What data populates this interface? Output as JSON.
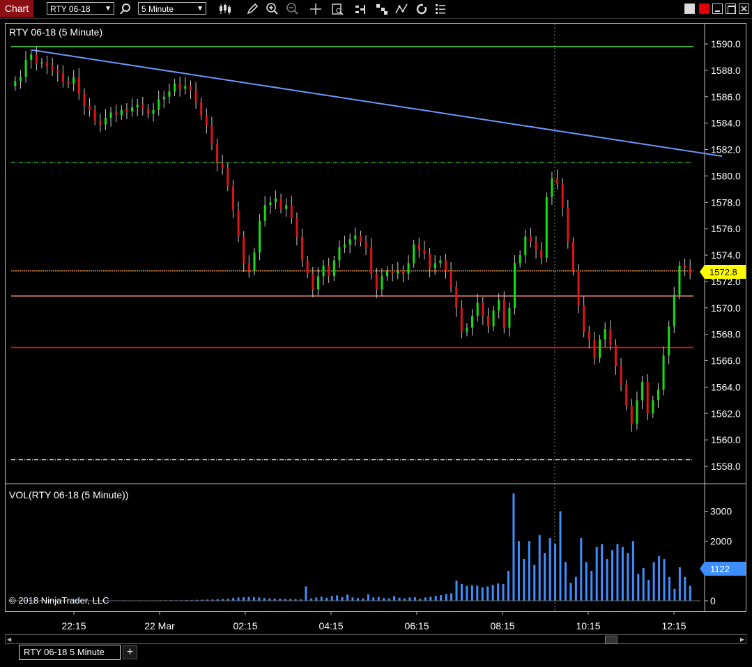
{
  "window": {
    "tab_label": "Chart",
    "instrument_select": "RTY 06-18",
    "interval_select": "5 Minute",
    "bottom_tab_label": "RTY 06-18 5 Minute",
    "add_tab_label": "+"
  },
  "toolbar_icons": [
    "search-icon",
    "bar-type-icon",
    "pencil-icon",
    "zoom-in-icon",
    "zoom-out-icon",
    "crosshair-icon",
    "data-box-icon",
    "indicators-icon",
    "strategies-icon",
    "drawing-tools-icon",
    "refresh-icon",
    "properties-icon"
  ],
  "colors": {
    "up": "#14e014",
    "down": "#e01414",
    "trend": "#6f95ff",
    "volume": "#3d8fff",
    "price_marker": "#ffff00",
    "tab_bg": "#8b0f14"
  },
  "price_panel": {
    "title": "RTY 06-18 (5 Minute)",
    "price_marker_label": "1572.8",
    "y_ticks": [
      "1590.0",
      "1588.0",
      "1586.0",
      "1584.0",
      "1582.0",
      "1580.0",
      "1578.0",
      "1576.0",
      "1574.0",
      "1572.0",
      "1570.0",
      "1568.0",
      "1566.0",
      "1564.0",
      "1562.0",
      "1560.0",
      "1558.0"
    ]
  },
  "volume_panel": {
    "title": "VOL(RTY 06-18 (5 Minute))",
    "marker_label": "1122",
    "y_ticks": [
      "3000",
      "2000",
      "0"
    ],
    "copyright": "© 2018 NinjaTrader, LLC"
  },
  "x_ticks": [
    "22:15",
    "22 Mar",
    "02:15",
    "04:15",
    "06:15",
    "08:15",
    "10:15",
    "12:15"
  ],
  "chart_data": [
    {
      "type": "candlestick",
      "title": "RTY 06-18 (5 Minute)",
      "ylim": [
        1557.5,
        1591.5
      ],
      "series": [
        {
          "name": "RTY 06-18",
          "open": [
            1586.8,
            1587.2,
            1587.5,
            1588.8,
            1589.2,
            1588.5,
            1588.6,
            1588.3,
            1588.0,
            1587.8,
            1587.2,
            1587.0,
            1587.5,
            1586.2,
            1585.3,
            1585.0,
            1584.2,
            1583.9,
            1584.4,
            1584.8,
            1584.6,
            1585.0,
            1584.9,
            1585.2,
            1585.4,
            1585.1,
            1584.7,
            1585.0,
            1585.8,
            1586.0,
            1586.4,
            1587.0,
            1586.6,
            1586.8,
            1586.5,
            1585.6,
            1584.6,
            1583.8,
            1582.4,
            1581.0,
            1580.6,
            1579.2,
            1577.4,
            1575.4,
            1573.4,
            1572.8,
            1574.2,
            1576.6,
            1577.8,
            1578.0,
            1578.3,
            1577.5,
            1577.8,
            1576.8,
            1575.4,
            1573.6,
            1572.6,
            1571.4,
            1572.4,
            1573.2,
            1572.4,
            1573.6,
            1574.6,
            1574.8,
            1575.2,
            1575.5,
            1575.0,
            1574.6,
            1572.6,
            1571.4,
            1572.4,
            1572.8,
            1572.6,
            1572.8,
            1572.6,
            1573.4,
            1574.8,
            1574.4,
            1574.1,
            1573.0,
            1573.4,
            1573.6,
            1572.8,
            1571.6,
            1570.0,
            1568.2,
            1568.5,
            1569.4,
            1570.4,
            1569.4,
            1568.6,
            1569.8,
            1570.6,
            1568.5,
            1570.0,
            1573.4,
            1574.0,
            1575.4,
            1575.0,
            1574.4,
            1573.8,
            1578.4,
            1579.8,
            1579.4,
            1577.6,
            1575.0,
            1572.8,
            1570.2,
            1568.2,
            1567.6,
            1566.2,
            1567.6,
            1568.4,
            1567.2,
            1565.6,
            1564.2,
            1562.6,
            1561.2,
            1563.0,
            1564.4,
            1562.0,
            1563.0,
            1563.8,
            1566.4,
            1568.6,
            1571.0,
            1573.2,
            1573.0
          ],
          "close": [
            1587.2,
            1587.5,
            1588.8,
            1589.2,
            1588.5,
            1588.6,
            1588.3,
            1588.0,
            1587.8,
            1587.2,
            1587.0,
            1587.5,
            1586.2,
            1585.3,
            1585.0,
            1584.2,
            1583.9,
            1584.4,
            1584.8,
            1584.6,
            1585.0,
            1584.9,
            1585.2,
            1585.4,
            1585.1,
            1584.7,
            1585.0,
            1585.8,
            1586.0,
            1586.4,
            1587.0,
            1586.6,
            1586.8,
            1586.5,
            1585.6,
            1584.6,
            1583.8,
            1582.4,
            1581.0,
            1580.6,
            1579.2,
            1577.4,
            1575.4,
            1573.4,
            1572.8,
            1574.2,
            1576.6,
            1577.8,
            1578.0,
            1578.3,
            1577.5,
            1577.8,
            1576.8,
            1575.4,
            1573.6,
            1572.6,
            1571.4,
            1572.4,
            1573.2,
            1572.4,
            1573.6,
            1574.6,
            1574.8,
            1575.2,
            1575.5,
            1575.0,
            1574.6,
            1572.6,
            1571.4,
            1572.4,
            1572.8,
            1572.6,
            1572.8,
            1572.6,
            1573.4,
            1574.8,
            1574.4,
            1574.1,
            1573.0,
            1573.4,
            1573.6,
            1572.8,
            1571.6,
            1570.0,
            1568.2,
            1568.5,
            1569.4,
            1570.4,
            1569.4,
            1568.6,
            1569.8,
            1570.6,
            1568.5,
            1570.0,
            1573.4,
            1574.0,
            1575.4,
            1575.0,
            1574.4,
            1573.8,
            1578.4,
            1579.8,
            1579.4,
            1577.6,
            1575.0,
            1572.8,
            1570.2,
            1568.2,
            1567.6,
            1566.2,
            1567.6,
            1568.4,
            1567.2,
            1565.6,
            1564.2,
            1562.6,
            1561.2,
            1563.0,
            1564.4,
            1562.0,
            1563.0,
            1563.8,
            1566.4,
            1568.6,
            1571.0,
            1573.2,
            1573.0,
            1572.6
          ]
        }
      ],
      "horizontal_lines": [
        {
          "price": 1589.8,
          "color": "#3fbf3f",
          "style": "solid"
        },
        {
          "price": 1581.0,
          "color": "#2fa02f",
          "style": "dashdot"
        },
        {
          "price": 1572.8,
          "color": "#ffa040",
          "style": "dotted"
        },
        {
          "price": 1570.9,
          "color": "#ff8a80",
          "style": "solid"
        },
        {
          "price": 1567.0,
          "color": "#e01414",
          "style": "solid"
        },
        {
          "price": 1558.5,
          "color": "#dddddd",
          "style": "dashdot"
        }
      ],
      "trend_line": {
        "from_price": 1589.8,
        "to_price": 1581.6
      }
    },
    {
      "type": "bar",
      "title": "VOL(RTY 06-18 (5 Minute))",
      "ylim": [
        0,
        3700
      ],
      "series": [
        {
          "name": "VOL",
          "values": [
            20,
            15,
            18,
            25,
            22,
            20,
            15,
            18,
            20,
            15,
            12,
            18,
            20,
            15,
            16,
            14,
            12,
            15,
            18,
            15,
            12,
            16,
            14,
            12,
            15,
            14,
            12,
            15,
            18,
            16,
            20,
            15,
            18,
            22,
            25,
            30,
            35,
            40,
            45,
            55,
            60,
            70,
            90,
            110,
            120,
            130,
            120,
            110,
            90,
            80,
            75,
            70,
            65,
            60,
            55,
            50,
            480,
            80,
            110,
            140,
            100,
            160,
            180,
            120,
            210,
            110,
            90,
            80,
            220,
            110,
            130,
            90,
            80,
            160,
            100,
            80,
            110,
            120,
            70,
            110,
            140,
            160,
            190,
            230,
            250,
            680,
            560,
            500,
            520,
            500,
            450,
            480,
            530,
            580,
            560,
            1000,
            3600,
            2000,
            1400,
            2000,
            1200,
            2200,
            1600,
            2100,
            1900,
            3000,
            1300,
            600,
            800,
            2100,
            1300,
            1000,
            1800,
            1900,
            1400,
            1700,
            1900,
            1800,
            1600,
            2000,
            900,
            1100,
            700,
            1300,
            1500,
            1400,
            800,
            400,
            1122,
            800,
            500
          ]
        }
      ]
    }
  ]
}
